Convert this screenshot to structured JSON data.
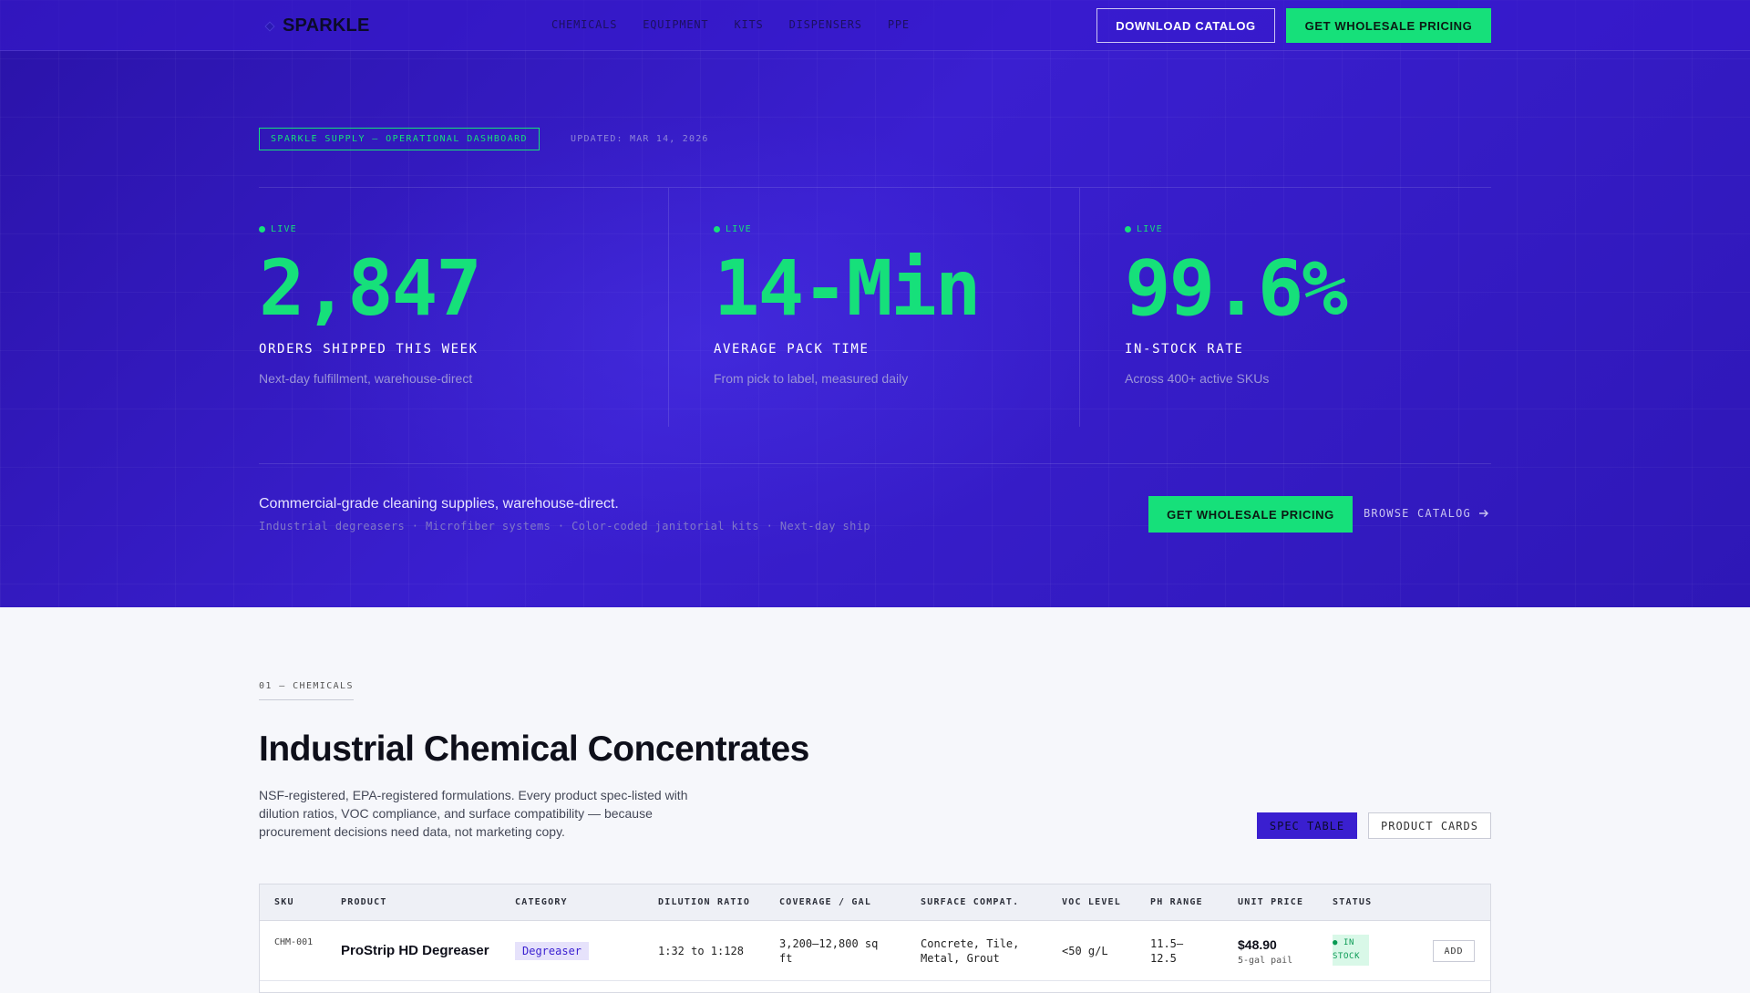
{
  "brand": {
    "name": "SPARKLE"
  },
  "nav": {
    "links": [
      "CHEMICALS",
      "EQUIPMENT",
      "KITS",
      "DISPENSERS",
      "PPE"
    ],
    "download_label": "DOWNLOAD CATALOG",
    "pricing_label": "GET WHOLESALE PRICING"
  },
  "hero": {
    "tag": "SPARKLE SUPPLY — OPERATIONAL DASHBOARD",
    "updated": "UPDATED: MAR 14, 2026",
    "stats": [
      {
        "live": "LIVE",
        "value": "2,847",
        "label": "ORDERS SHIPPED THIS WEEK",
        "sub": "Next-day fulfillment, warehouse-direct"
      },
      {
        "live": "LIVE",
        "value": "14-Min",
        "label": "AVERAGE PACK TIME",
        "sub": "From pick to label, measured daily"
      },
      {
        "live": "LIVE",
        "value": "99.6%",
        "label": "IN-STOCK RATE",
        "sub": "Across 400+ active SKUs"
      }
    ],
    "tagline": "Commercial-grade cleaning supplies, warehouse-direct.",
    "features": "Industrial degreasers · Microfiber systems · Color-coded janitorial kits · Next-day ship",
    "cta_label": "GET WHOLESALE PRICING",
    "browse_label": "BROWSE CATALOG"
  },
  "section": {
    "label": "01 — CHEMICALS",
    "title": "Industrial Chemical Concentrates",
    "description": "NSF-registered, EPA-registered formulations. Every product spec-listed with dilution ratios, VOC compliance, and surface compatibility — because procurement decisions need data, not marketing copy.",
    "view_spec": "SPEC TABLE",
    "view_cards": "PRODUCT CARDS"
  },
  "table": {
    "headers": [
      "SKU",
      "PRODUCT",
      "CATEGORY",
      "DILUTION RATIO",
      "COVERAGE / GAL",
      "SURFACE COMPAT.",
      "VOC LEVEL",
      "PH RANGE",
      "UNIT PRICE",
      "STATUS"
    ],
    "rows": [
      {
        "sku": "CHM-001",
        "product": "ProStrip HD Degreaser",
        "category": "Degreaser",
        "dilution": "1:32 to 1:128",
        "coverage": "3,200–12,800 sq ft",
        "surface": "Concrete, Tile, Metal, Grout",
        "voc": "<50 g/L",
        "ph": "11.5–12.5",
        "price": "$48.90",
        "unit": "5-gal pail",
        "status": "● IN STOCK",
        "action": "ADD"
      }
    ]
  },
  "colors": {
    "accent": "#16e07a",
    "hero_bg": "#3a1fd0",
    "page_bg": "#f6f7fb"
  }
}
